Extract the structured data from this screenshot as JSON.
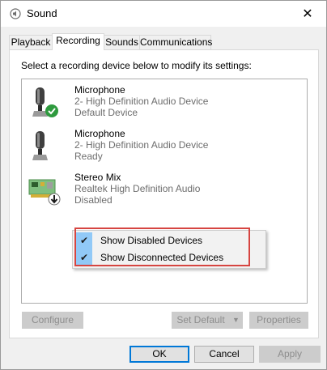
{
  "window": {
    "title": "Sound",
    "close_glyph": "✕"
  },
  "tabs": [
    {
      "label": "Playback",
      "active": false
    },
    {
      "label": "Recording",
      "active": true
    },
    {
      "label": "Sounds",
      "active": false
    },
    {
      "label": "Communications",
      "active": false
    }
  ],
  "panel": {
    "instruction": "Select a recording device below to modify its settings:"
  },
  "devices": [
    {
      "name": "Microphone",
      "description": "2- High Definition Audio Device",
      "status": "Default Device",
      "icon": "microphone-icon",
      "badge": "default-check-badge"
    },
    {
      "name": "Microphone",
      "description": "2- High Definition Audio Device",
      "status": "Ready",
      "icon": "microphone-icon",
      "badge": ""
    },
    {
      "name": "Stereo Mix",
      "description": "Realtek High Definition Audio",
      "status": "Disabled",
      "icon": "sound-card-icon",
      "badge": "disabled-arrow-badge"
    }
  ],
  "context_menu": {
    "items": [
      {
        "label": "Show Disabled Devices",
        "checked": true
      },
      {
        "label": "Show Disconnected Devices",
        "checked": true
      }
    ],
    "check_glyph": "✔"
  },
  "panel_buttons": {
    "configure": "Configure",
    "set_default": "Set Default",
    "dropdown_glyph": "▼",
    "properties": "Properties"
  },
  "footer_buttons": {
    "ok": "OK",
    "cancel": "Cancel",
    "apply": "Apply"
  },
  "colors": {
    "highlight_border": "#d64541",
    "check_background": "#91c9f7",
    "default_badge": "#2e9a3e"
  }
}
